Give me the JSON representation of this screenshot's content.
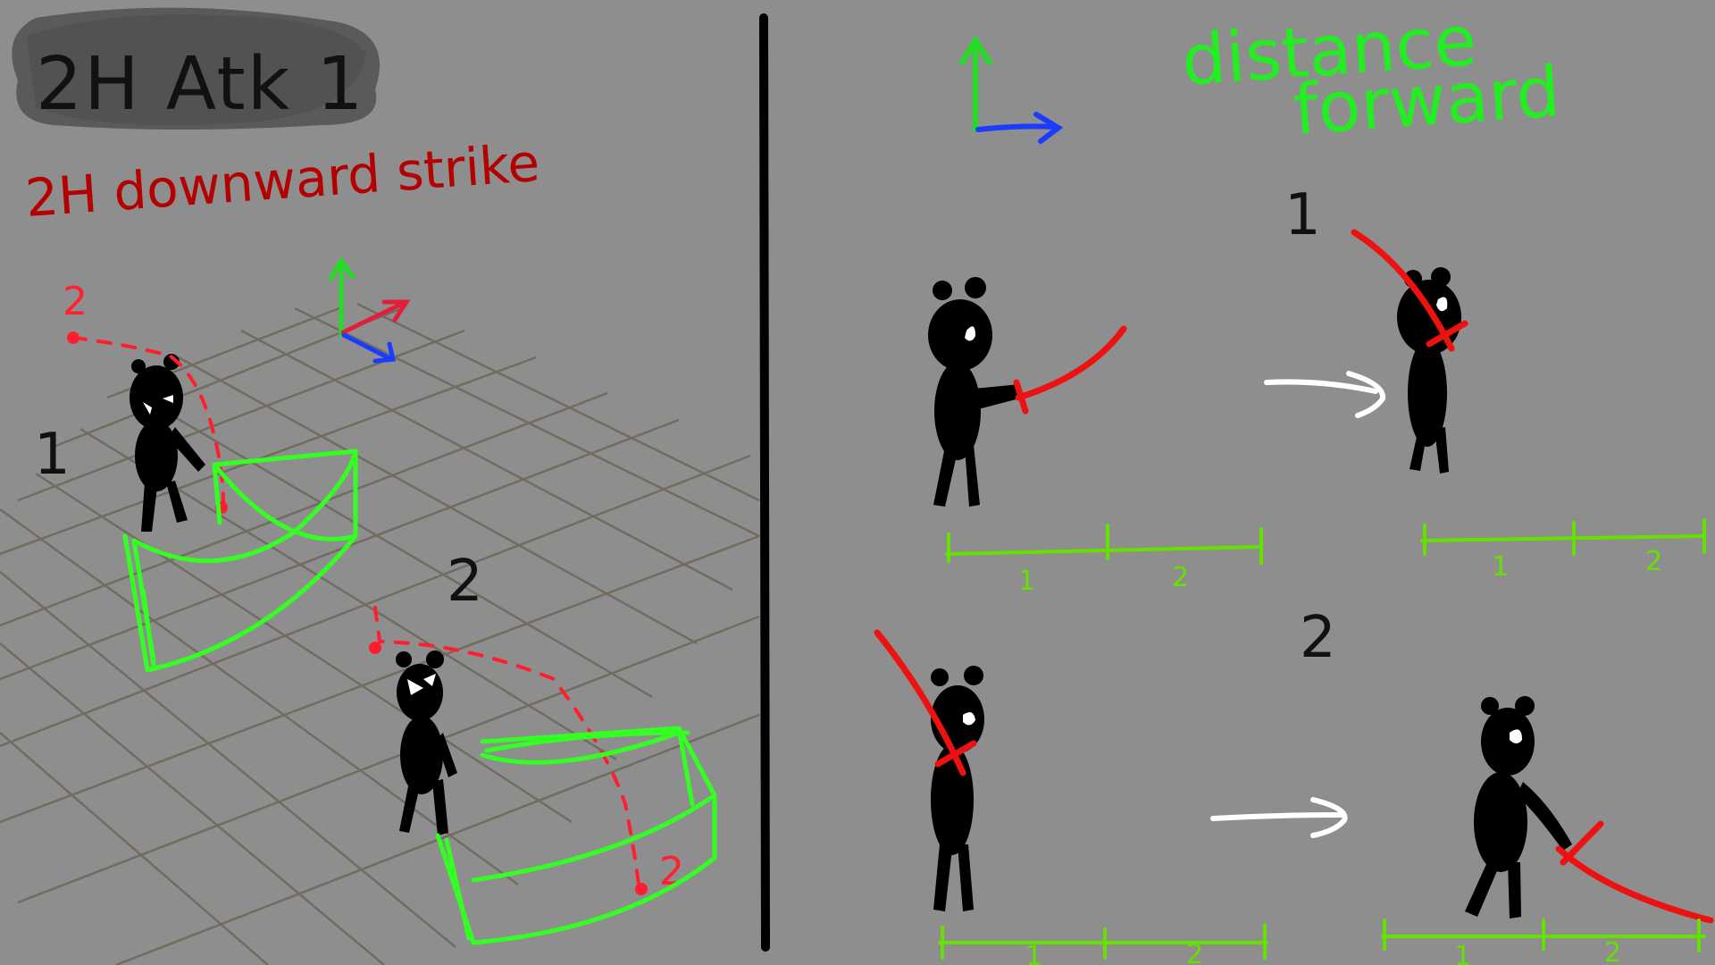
{
  "title": "2H Atk 1",
  "subtitle": "2H downward strike",
  "left_panel": {
    "step_1_label": "1",
    "step_2_label": "2",
    "marker_2_labels": [
      "2",
      "2",
      "2"
    ]
  },
  "right_panel": {
    "distance_label_line1": "distance",
    "distance_label_line2": "forward",
    "row_1_label": "1",
    "row_2_label": "2",
    "ruler_tick_labels": [
      "1",
      "2"
    ]
  },
  "colors": {
    "background": "#8e8e8e",
    "axis_up": "#22dd22",
    "axis_right": "#1a3cff",
    "axis_depth": "#e0203a",
    "swing": "#ee1111",
    "arc_area": "#33ff22",
    "ruler": "#66e000",
    "motion_arrow": "#ffffff",
    "character": "#000000"
  }
}
